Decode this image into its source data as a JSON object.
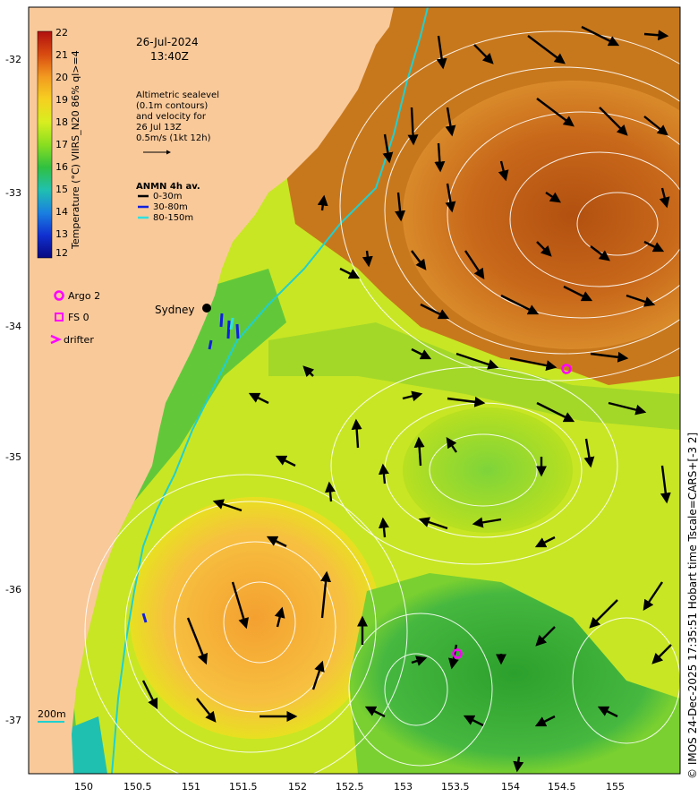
{
  "map": {
    "date": "26-Jul-2024",
    "time": "13:40Z",
    "colorbar": {
      "title": "Temperature (°C) VIIRS_N20 86% ql>=4",
      "min": 12,
      "max": 22,
      "tick_labels": [
        "22",
        "21",
        "20",
        "19",
        "18",
        "17",
        "16",
        "15",
        "14",
        "13",
        "12"
      ]
    },
    "altimetry_note": [
      "Altimetric sealevel",
      "(0.1m contours)",
      "and velocity for",
      "26 Jul 13Z",
      "0.5m/s (1kt 12h)"
    ],
    "anmn": {
      "title": "ANMN 4h av.",
      "items": [
        {
          "label": "0-30m",
          "color": "#000000"
        },
        {
          "label": "30-80m",
          "color": "#1020e0"
        },
        {
          "label": "80-150m",
          "color": "#30e0e0"
        }
      ]
    },
    "legend": {
      "argo": "Argo 2",
      "fs": "FS 0",
      "drifter": "drifter"
    },
    "city": "Sydney",
    "depth_label": "200m",
    "lat_labels": [
      "-32",
      "-33",
      "-34",
      "-35",
      "-36",
      "-37"
    ],
    "lon_labels": [
      "150",
      "150.5",
      "151",
      "151.5",
      "152",
      "152.5",
      "153",
      "153.5",
      "154",
      "154.5",
      "155"
    ],
    "credit": "© IMOS 24-Dec-2025 17:35:51 Hobart time Tscale=CARS+[-3 2]",
    "colors": {
      "land": "#f9c99a",
      "warm_core": "#b85a10",
      "marker": "#ff00ff",
      "isobath": "#20d0d0"
    }
  }
}
